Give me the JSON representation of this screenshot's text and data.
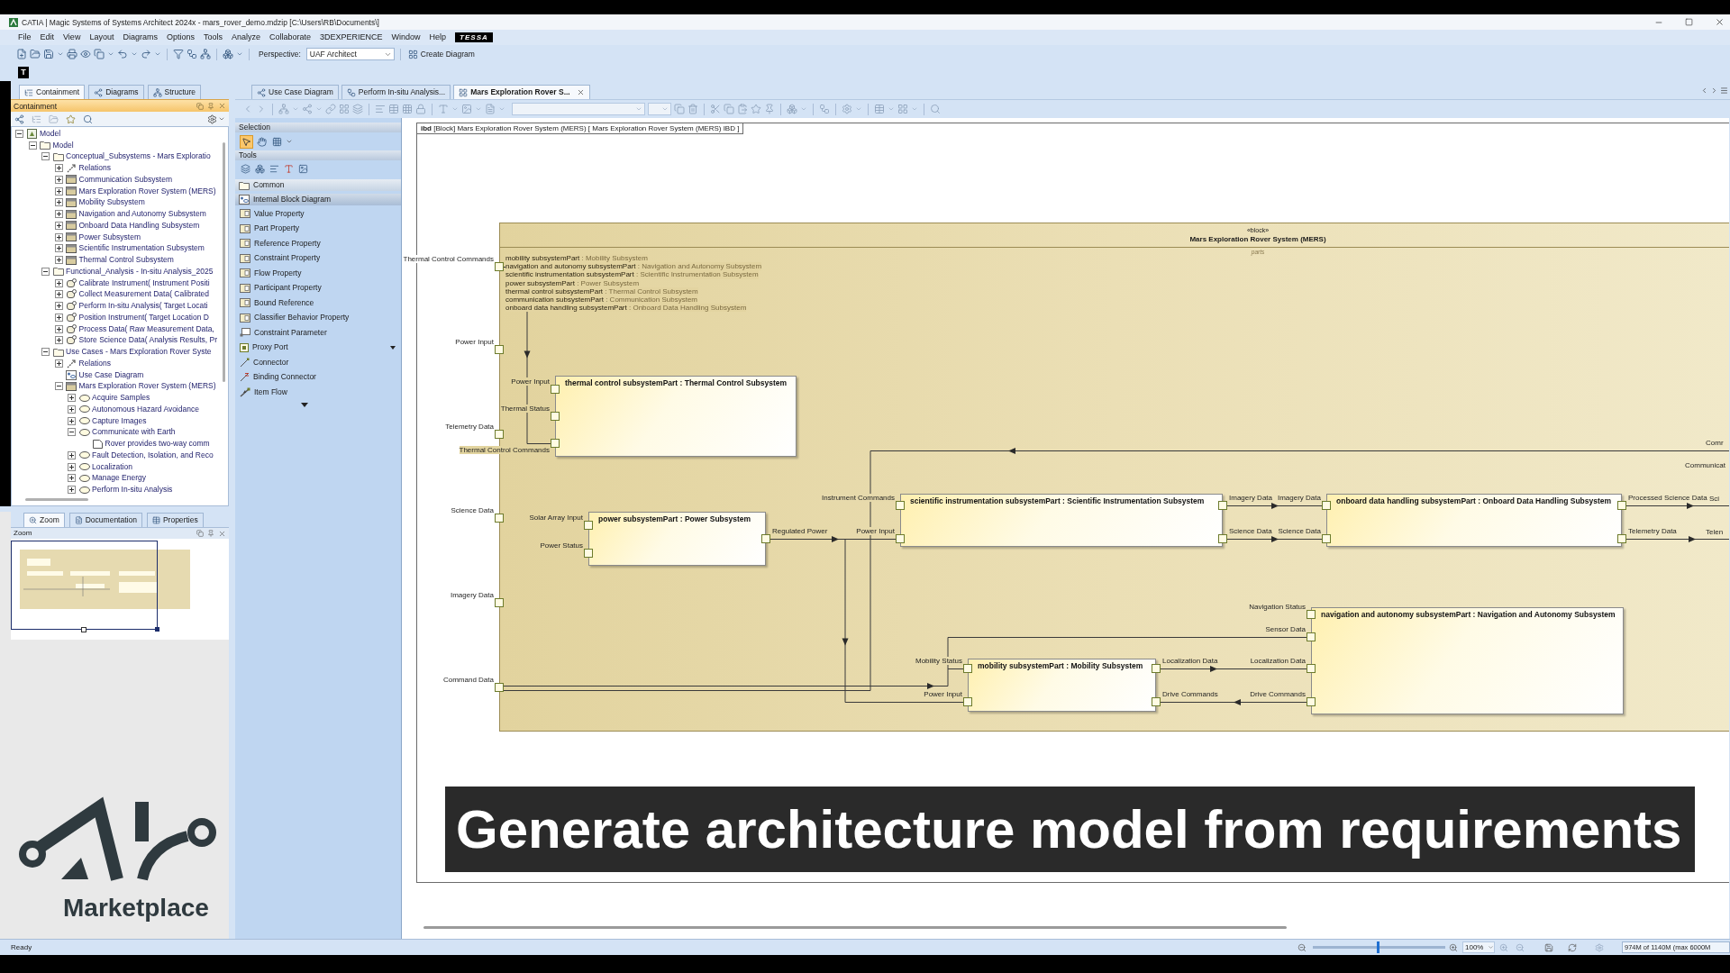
{
  "window": {
    "title": "CATIA | Magic Systems of Systems Architect 2024x - mars_rover_demo.mdzip [C:\\Users\\RB\\Documents\\]"
  },
  "menu": [
    {
      "label": "File",
      "kind": "item"
    },
    {
      "label": "Edit",
      "kind": "item"
    },
    {
      "label": "View",
      "kind": "item"
    },
    {
      "label": "Layout",
      "kind": "item"
    },
    {
      "label": "Diagrams",
      "kind": "item"
    },
    {
      "label": "Options",
      "kind": "item"
    },
    {
      "label": "Tools",
      "kind": "item"
    },
    {
      "label": "Analyze",
      "kind": "item"
    },
    {
      "label": "Collaborate",
      "kind": "item"
    },
    {
      "label": "3DEXPERIENCE",
      "kind": "item"
    },
    {
      "label": "Window",
      "kind": "item"
    },
    {
      "label": "Help",
      "kind": "item"
    },
    {
      "label": "TESSA",
      "kind": "badge"
    }
  ],
  "toolbar": {
    "perspective_label": "Perspective:",
    "perspective": "UAF Architect",
    "create_diagram": "Create Diagram",
    "tile": "T"
  },
  "left_tabs": [
    {
      "label": "Containment",
      "selected": true
    },
    {
      "label": "Diagrams",
      "selected": false
    },
    {
      "label": "Structure",
      "selected": false
    }
  ],
  "containment": {
    "title": "Containment",
    "tree": [
      {
        "label": "Model",
        "kind": "model",
        "expanded": true,
        "children": [
          {
            "label": "Model",
            "kind": "folder",
            "expanded": true,
            "children": [
              {
                "label": "Conceptual_Subsystems - Mars Exploratio",
                "kind": "folder",
                "expanded": true,
                "children": [
                  {
                    "label": "Relations",
                    "kind": "relations",
                    "expanded": false
                  },
                  {
                    "label": "Communication Subsystem",
                    "kind": "block",
                    "expanded": false
                  },
                  {
                    "label": "Mars Exploration Rover System (MERS)",
                    "kind": "block",
                    "expanded": false
                  },
                  {
                    "label": "Mobility Subsystem",
                    "kind": "block",
                    "expanded": false
                  },
                  {
                    "label": "Navigation and Autonomy Subsystem",
                    "kind": "block",
                    "expanded": false
                  },
                  {
                    "label": "Onboard Data Handling Subsystem",
                    "kind": "block",
                    "expanded": false
                  },
                  {
                    "label": "Power Subsystem",
                    "kind": "block",
                    "expanded": false
                  },
                  {
                    "label": "Scientific Instrumentation Subsystem",
                    "kind": "block",
                    "expanded": false
                  },
                  {
                    "label": "Thermal Control Subsystem",
                    "kind": "block",
                    "expanded": false
                  }
                ]
              },
              {
                "label": "Functional_Analysis - In-situ Analysis_2025",
                "kind": "folder",
                "expanded": true,
                "children": [
                  {
                    "label": "Calibrate Instrument( Instrument Positi",
                    "kind": "activity",
                    "expanded": false
                  },
                  {
                    "label": "Collect Measurement Data( Calibrated",
                    "kind": "activity",
                    "expanded": false
                  },
                  {
                    "label": "Perform In-situ Analysis( Target Locati",
                    "kind": "activity",
                    "expanded": false
                  },
                  {
                    "label": "Position Instrument( Target Location D",
                    "kind": "activity",
                    "expanded": false
                  },
                  {
                    "label": "Process Data( Raw Measurement Data,",
                    "kind": "activity",
                    "expanded": false
                  },
                  {
                    "label": "Store Science Data( Analysis Results, Pr",
                    "kind": "activity",
                    "expanded": false
                  }
                ]
              },
              {
                "label": "Use Cases - Mars Exploration Rover Syste",
                "kind": "folder",
                "expanded": true,
                "children": [
                  {
                    "label": "Relations",
                    "kind": "relations",
                    "expanded": false
                  },
                  {
                    "label": "Use Case Diagram",
                    "kind": "diagram"
                  },
                  {
                    "label": "Mars Exploration Rover System (MERS)",
                    "kind": "block",
                    "expanded": true,
                    "children": [
                      {
                        "label": "Acquire Samples",
                        "kind": "usecase",
                        "expanded": false
                      },
                      {
                        "label": "Autonomous Hazard Avoidance",
                        "kind": "usecase",
                        "expanded": false
                      },
                      {
                        "label": "Capture Images",
                        "kind": "usecase",
                        "expanded": false
                      },
                      {
                        "label": "Communicate with Earth",
                        "kind": "usecase",
                        "expanded": true,
                        "children": [
                          {
                            "label": "Rover provides two-way comm",
                            "kind": "note"
                          }
                        ]
                      },
                      {
                        "label": "Fault Detection, Isolation, and Reco",
                        "kind": "usecase",
                        "expanded": false
                      },
                      {
                        "label": "Localization",
                        "kind": "usecase",
                        "expanded": false
                      },
                      {
                        "label": "Manage Energy",
                        "kind": "usecase",
                        "expanded": false
                      },
                      {
                        "label": "Perform In-situ Analysis",
                        "kind": "usecase",
                        "expanded": false
                      }
                    ]
                  }
                ]
              }
            ]
          }
        ]
      }
    ]
  },
  "lower_tabs": [
    {
      "label": "Zoom",
      "selected": true
    },
    {
      "label": "Documentation",
      "selected": false
    },
    {
      "label": "Properties",
      "selected": false
    }
  ],
  "zoom_panel": {
    "title": "Zoom"
  },
  "logo": {
    "text": "Marketplace"
  },
  "editor_tabs": [
    {
      "label": "Use Case Diagram",
      "selected": false
    },
    {
      "label": "Perform In-situ Analysis...",
      "selected": false
    },
    {
      "label": "Mars Exploration Rover S...",
      "selected": true
    }
  ],
  "palette": {
    "selection": {
      "title": "Selection",
      "tools": [
        {
          "kind": "pointer",
          "selected": true
        },
        {
          "kind": "pan",
          "selected": false
        },
        {
          "kind": "marquee",
          "selected": false
        }
      ]
    },
    "tools_title": "Tools",
    "groups": [
      {
        "label": "Common",
        "kind": "folder",
        "expanded": false
      },
      {
        "label": "Internal Block Diagram",
        "kind": "diagram",
        "expanded": true,
        "items": [
          {
            "label": "Value Property",
            "kind": "tile",
            "submenu": false
          },
          {
            "label": "Part Property",
            "kind": "tile",
            "submenu": false
          },
          {
            "label": "Reference Property",
            "kind": "tile",
            "submenu": false
          },
          {
            "label": "Constraint Property",
            "kind": "tile",
            "submenu": false
          },
          {
            "label": "Flow Property",
            "kind": "tile",
            "submenu": false
          },
          {
            "label": "Participant Property",
            "kind": "tile",
            "submenu": false
          },
          {
            "label": "Bound Reference",
            "kind": "tile",
            "submenu": false
          },
          {
            "label": "Classifier Behavior Property",
            "kind": "tile",
            "submenu": false
          },
          {
            "label": "Constraint Parameter",
            "kind": "parameter",
            "submenu": false
          },
          {
            "label": "Proxy Port",
            "kind": "port",
            "submenu": true
          },
          {
            "label": "Connector",
            "kind": "connector",
            "submenu": false
          },
          {
            "label": "Binding Connector",
            "kind": "binding",
            "submenu": false
          },
          {
            "label": "Item Flow",
            "kind": "flow",
            "submenu": false
          }
        ]
      }
    ]
  },
  "diagram": {
    "frame_label": "**ibd** [Block] Mars Exploration Rover System (MERS) [ Mars Exploration Rover System (MERS) IBD ]",
    "block": {
      "stereotype": "«block»",
      "name": "Mars Exploration Rover System (MERS)",
      "compartment": "parts",
      "part_list": [
        {
          "name": "mobility subsystemPart",
          "type": ": Mobility Subsystem"
        },
        {
          "name": "navigation and autonomy subsystemPart",
          "type": ": Navigation and Autonomy Subsystem"
        },
        {
          "name": "scientific instrumentation subsystemPart",
          "type": ": Scientific Instrumentation Subsystem"
        },
        {
          "name": "power subsystemPart",
          "type": ": Power Subsystem"
        },
        {
          "name": "thermal control subsystemPart",
          "type": ": Thermal Control Subsystem"
        },
        {
          "name": "communication subsystemPart",
          "type": ": Communication Subsystem"
        },
        {
          "name": "onboard data handling subsystemPart",
          "type": ": Onboard Data Handling Subsystem"
        }
      ],
      "ports": [
        {
          "label": "Thermal Control Commands"
        },
        {
          "label": "Power Input"
        },
        {
          "label": "Telemetry Data"
        },
        {
          "label": "Science Data"
        },
        {
          "label": "Imagery Data"
        },
        {
          "label": "Command Data"
        }
      ],
      "edge_labels": [
        "Comr",
        "Communicat",
        "Sci",
        "Telen"
      ]
    },
    "parts": [
      {
        "title": "thermal control subsystemPart : Thermal Control Subsystem",
        "ports": [
          {
            "label": "Power Input",
            "kind": "left"
          },
          {
            "label": "Thermal Status",
            "kind": "left"
          },
          {
            "label": "Thermal Control Commands",
            "kind": "left"
          }
        ]
      },
      {
        "title": "power subsystemPart : Power Subsystem",
        "ports": [
          {
            "label": "Solar Array Input",
            "kind": "left"
          },
          {
            "label": "Power Status",
            "kind": "left"
          },
          {
            "label": "Regulated Power",
            "kind": "right"
          }
        ]
      },
      {
        "title": "scientific instrumentation subsystemPart : Scientific Instrumentation Subsystem",
        "ports": [
          {
            "label": "Instrument Commands",
            "kind": "left"
          },
          {
            "label": "Power Input",
            "kind": "left"
          },
          {
            "label": "Imagery Data",
            "kind": "right"
          },
          {
            "label": "Science Data",
            "kind": "right"
          }
        ]
      },
      {
        "title": "onboard data handling subsystemPart : Onboard Data Handling Subsystem",
        "ports": [
          {
            "label": "Imagery Data",
            "kind": "left"
          },
          {
            "label": "Science Data",
            "kind": "left"
          },
          {
            "label": "Processed Science Data",
            "kind": "right"
          },
          {
            "label": "Telemetry Data",
            "kind": "right"
          }
        ]
      },
      {
        "title": "mobility subsystemPart : Mobility Subsystem",
        "ports": [
          {
            "label": "Mobility Status",
            "kind": "left"
          },
          {
            "label": "Power Input",
            "kind": "left"
          },
          {
            "label": "Localization Data",
            "kind": "right"
          },
          {
            "label": "Drive Commands",
            "kind": "right"
          }
        ]
      },
      {
        "title": "navigation and autonomy subsystemPart : Navigation and Autonomy Subsystem",
        "ports": [
          {
            "label": "Navigation Status",
            "kind": "left"
          },
          {
            "label": "Sensor Data",
            "kind": "left"
          },
          {
            "label": "Localization Data",
            "kind": "left"
          },
          {
            "label": "Drive Commands",
            "kind": "left"
          }
        ]
      }
    ]
  },
  "caption": "Generate architecture model from requirements",
  "status_bar": {
    "text": "Ready",
    "zoom_slider": {
      "level": 0.49
    },
    "zoom": "100%",
    "memory": "974M of 1140M (max 6000M"
  }
}
